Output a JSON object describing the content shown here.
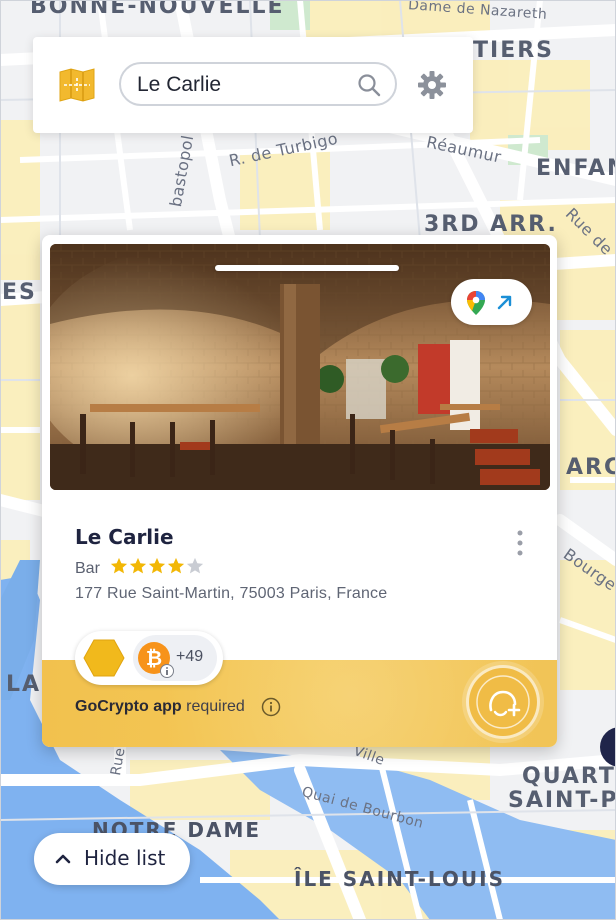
{
  "search": {
    "value": "Le Carlie",
    "placeholder": ""
  },
  "map": {
    "labels": {
      "bonne_nouvelle": "BONNE-NOUVELLE",
      "dame_de_nazareth": "Dame de Nazareth",
      "tiers": "TIERS",
      "r_de_turbigo": "R. de Turbigo",
      "reaumur": "Réaumur",
      "enfan": "ENFAN",
      "bastopol": "bastopol",
      "third_arr": "3RD ARR.",
      "rue_de": "Rue de",
      "es": "ES",
      "arc": "ARC",
      "bourge": "Bourge",
      "la_c": "LA C",
      "ville": "Ville",
      "rue_de_2": "Rue de",
      "quartier": "QUARTI",
      "saint_pa": "SAINT-PA",
      "quai_de_bourbon": "Quai de Bourbon",
      "notre_dame": "NOTRE DAME",
      "ile_saint_louis": "ÎLE SAINT-LOUIS"
    }
  },
  "place": {
    "name": "Le Carlie",
    "category": "Bar",
    "rating": 4,
    "rating_max": 5,
    "address": "177 Rue Saint-Martin, 75003 Paris, France",
    "coins_extra": "+49",
    "payment_app": "GoCrypto app",
    "payment_required": "required"
  },
  "actions": {
    "hide_list": "Hide list"
  },
  "icons": {
    "logo": "map-logo-icon",
    "search": "search-icon",
    "settings": "gear-icon",
    "maps": "google-maps-pin-icon",
    "open": "arrow-up-right-icon",
    "more": "more-vertical-icon",
    "star": "star-icon",
    "coin_primary": "hexagon-coin-icon",
    "coin_btc": "bitcoin-icon",
    "info": "info-icon",
    "gocrypto": "gocrypto-icon",
    "chevron": "chevron-up-icon"
  },
  "colors": {
    "accent_yellow": "#f2c14e",
    "star_filled": "#f2b705",
    "star_empty": "#c9ccd3",
    "text_dark": "#1f2440",
    "bitcoin": "#f7931a"
  }
}
